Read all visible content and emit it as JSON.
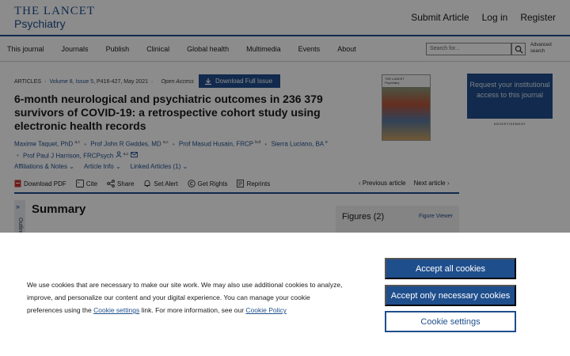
{
  "header": {
    "logo_line1": "THE LANCET",
    "logo_line2": "Psychiatry",
    "submit": "Submit Article",
    "login": "Log in",
    "register": "Register"
  },
  "nav": {
    "items": [
      "This journal",
      "Journals",
      "Publish",
      "Clinical",
      "Global health",
      "Multimedia",
      "Events",
      "About"
    ],
    "search_placeholder": "Search for...",
    "advanced_line1": "Advanced",
    "advanced_line2": "search"
  },
  "article": {
    "type": "ARTICLES",
    "issue": "Volume 8, Issue 5",
    "pages": "P416-427, May 2021",
    "access": "Open Access",
    "download_issue": "Download Full Issue",
    "title": "6-month neurological and psychiatric outcomes in 236 379 survivors of COVID-19: a retrospective cohort study using electronic health records",
    "authors": [
      {
        "name": "Maxime Taquet, PhD",
        "aff": "a,c"
      },
      {
        "name": "Prof John R Geddes, MD",
        "aff": "a,c"
      },
      {
        "name": "Prof Masud Husain, FRCP",
        "aff": "b,d"
      },
      {
        "name": "Sierra Luciano, BA",
        "aff": "e"
      },
      {
        "name": "Prof Paul J Harrison, FRCPsych",
        "aff": "a,c"
      }
    ],
    "info_links": [
      "Affiliations & Notes",
      "Article Info",
      "Linked Articles (1)"
    ],
    "tools": [
      "Download PDF",
      "Cite",
      "Share",
      "Set Alert",
      "Get Rights",
      "Reprints"
    ],
    "previous": "Previous article",
    "next": "Next article",
    "cover_title_1": "THE LANCET",
    "cover_title_2": "Psychiatry"
  },
  "sidebar": {
    "ad_text": "Request your institutional access to this journal",
    "ad_label": "ADVERTISEMENT",
    "figures_title": "Figures (2)",
    "figure_viewer": "Figure Viewer"
  },
  "summary": {
    "outline": "Outline",
    "title": "Summary"
  },
  "cookie": {
    "text_1": "We use cookies that are necessary to make our site work. We may also use additional cookies to analyze, improve, and personalize our content and your digital experience. You can manage your cookie preferences using the ",
    "settings_link": "Cookie settings",
    "text_2": " link. For more information, see our ",
    "policy_link": "Cookie Policy",
    "accept_all": "Accept all cookies",
    "accept_necessary": "Accept only necessary cookies",
    "settings_button": "Cookie settings"
  }
}
